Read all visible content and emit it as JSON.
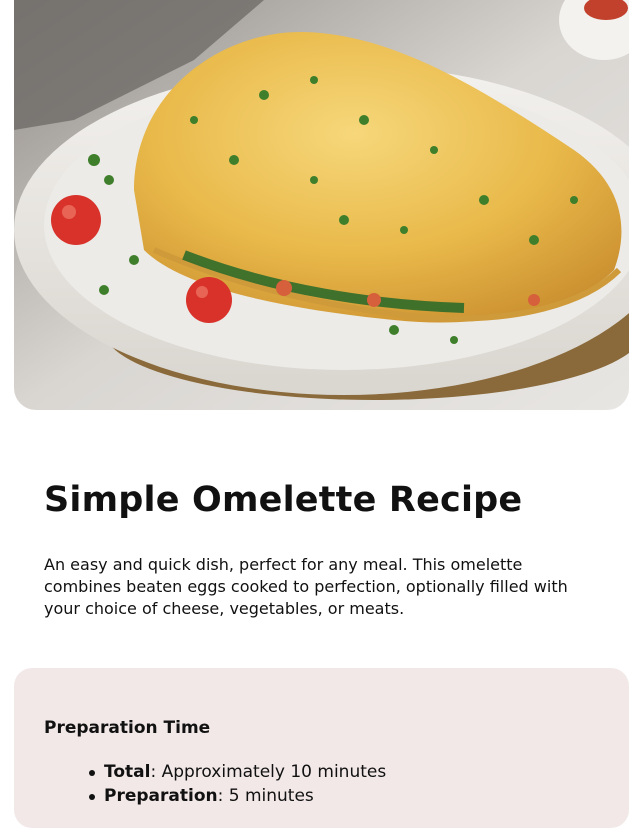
{
  "hero": {
    "image": "omelette-photo"
  },
  "recipe": {
    "title": "Simple Omelette Recipe",
    "description": "An easy and quick dish, perfect for any meal. This omelette combines beaten eggs cooked to perfection, optionally filled with your choice of cheese, vegetables, or meats."
  },
  "preparation": {
    "heading": "Preparation Time",
    "items": [
      {
        "label": "Total",
        "value": ": Approximately 10 minutes"
      },
      {
        "label": "Preparation",
        "value": ": 5 minutes"
      }
    ]
  },
  "colors": {
    "card_background": "#f2e8e8",
    "text": "#111111"
  }
}
